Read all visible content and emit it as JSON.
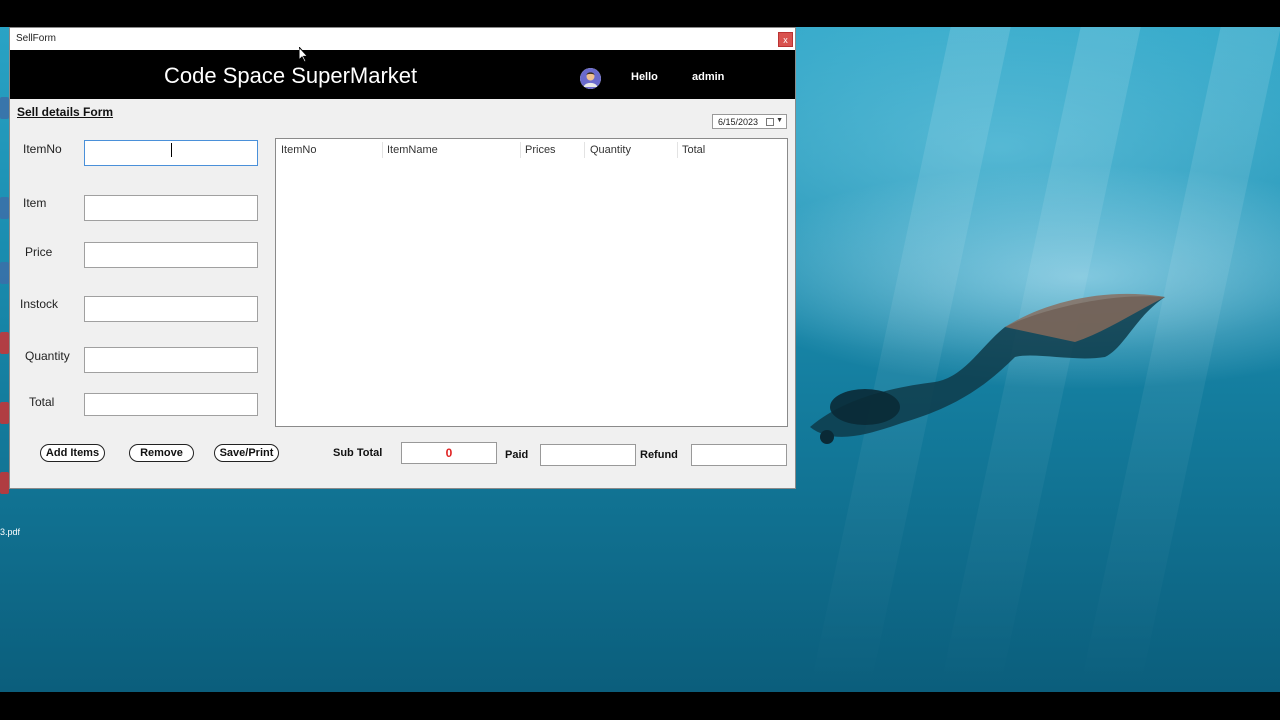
{
  "window": {
    "title": "SellForm",
    "close_label": "x"
  },
  "header": {
    "app_title": "Code Space SuperMarket",
    "greeting": "Hello",
    "username": "admin"
  },
  "form": {
    "heading": "Sell details Form",
    "date": "6/15/2023",
    "fields": {
      "itemno": {
        "label": "ItemNo",
        "value": ""
      },
      "item": {
        "label": "Item",
        "value": ""
      },
      "price": {
        "label": "Price",
        "value": ""
      },
      "instock": {
        "label": "Instock",
        "value": ""
      },
      "quantity": {
        "label": "Quantity",
        "value": ""
      },
      "total": {
        "label": "Total",
        "value": ""
      }
    }
  },
  "grid": {
    "columns": [
      "ItemNo",
      "ItemName",
      "Prices",
      "Quantity",
      "Total"
    ],
    "rows": []
  },
  "buttons": {
    "add": "Add Items",
    "remove": "Remove",
    "save": "Save/Print"
  },
  "summary": {
    "subtotal_label": "Sub Total",
    "subtotal_value": "0",
    "paid_label": "Paid",
    "paid_value": "",
    "refund_label": "Refund",
    "refund_value": ""
  },
  "desktop": {
    "file_label": "3.pdf"
  },
  "colors": {
    "header_bg": "#000000",
    "subtotal_text": "#e02020",
    "close_button": "#d9534f"
  }
}
